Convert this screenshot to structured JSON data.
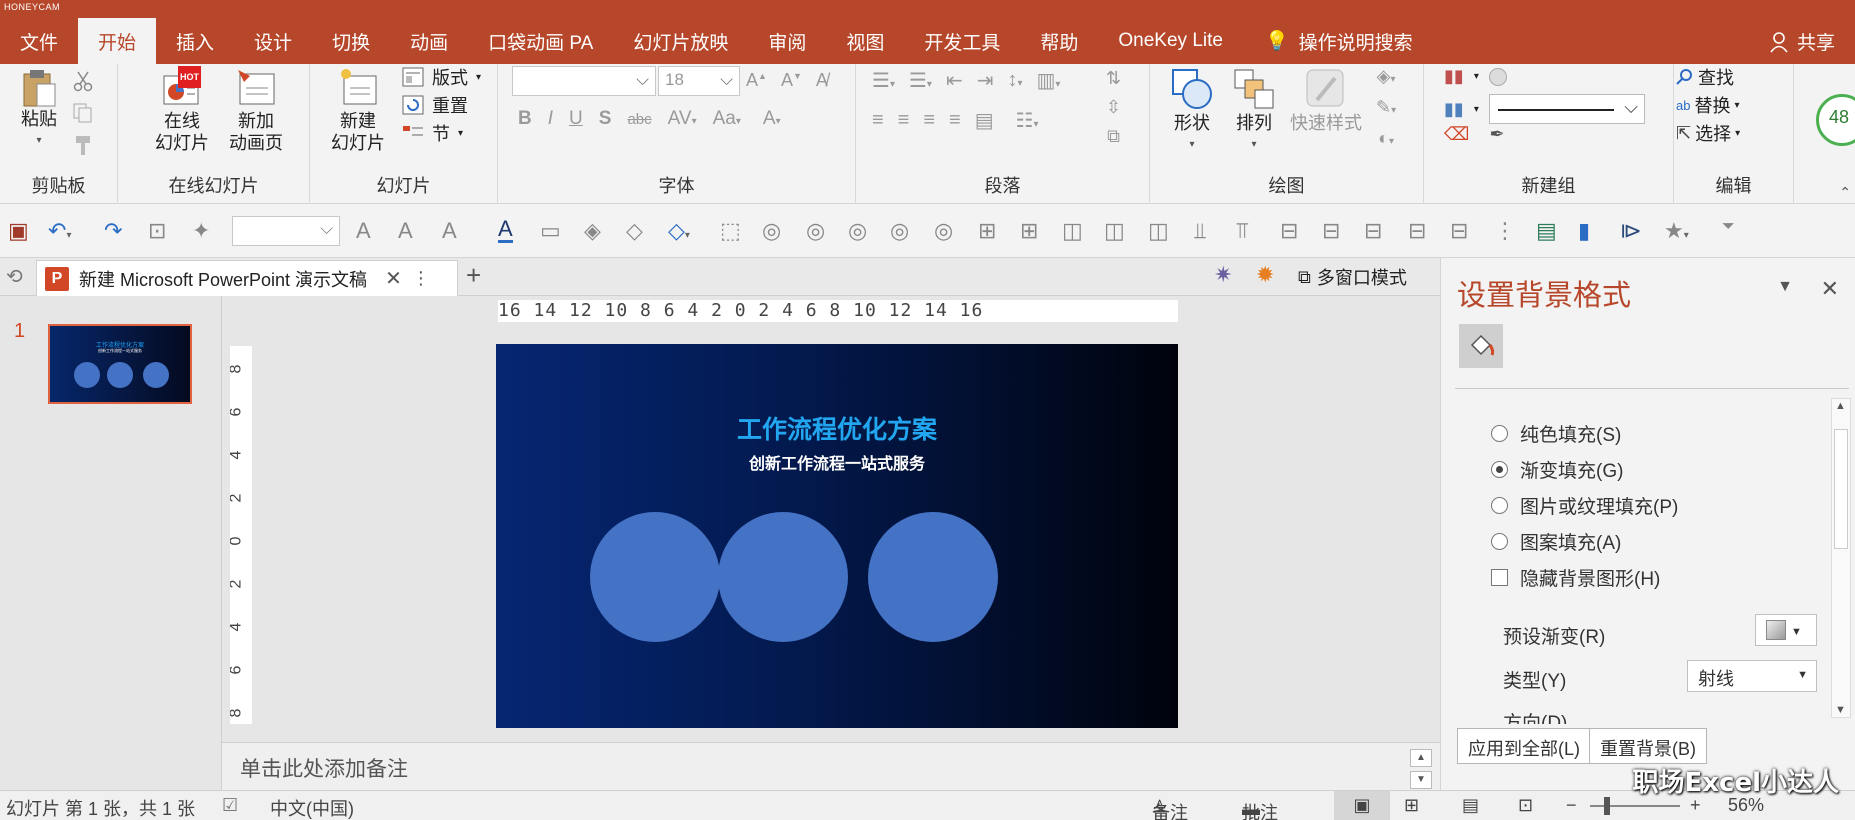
{
  "watermark_top": "HONEYCAM",
  "tabs": [
    "文件",
    "开始",
    "插入",
    "设计",
    "切换",
    "动画",
    "口袋动画 PA",
    "幻灯片放映",
    "审阅",
    "视图",
    "开发工具",
    "帮助",
    "OneKey Lite"
  ],
  "active_tab": "开始",
  "tell_me": "操作说明搜索",
  "share": "共享",
  "ribbon": {
    "clipboard": {
      "paste": "粘贴",
      "label": "剪贴板"
    },
    "online_slides": {
      "online": "在线\n幻灯片",
      "new_anim": "新加\n动画页",
      "hot": "HOT",
      "label": "在线幻灯片"
    },
    "slides": {
      "new_slide": "新建\n幻灯片",
      "layout": "版式",
      "reset": "重置",
      "section": "节",
      "label": "幻灯片"
    },
    "font": {
      "size": "18",
      "label": "字体"
    },
    "paragraph": {
      "label": "段落"
    },
    "drawing": {
      "shapes": "形状",
      "arrange": "排列",
      "quick_styles": "快速样式",
      "label": "绘图"
    },
    "new_group": {
      "label": "新建组"
    },
    "editing": {
      "find": "查找",
      "replace": "替换",
      "select": "选择",
      "label": "编辑"
    },
    "badge": "48"
  },
  "doc_tab": {
    "title": "新建 Microsoft  PowerPoint 演示文稿",
    "multiwin": "多窗口模式"
  },
  "thumb": {
    "number": "1",
    "title": "工作流程优化方案",
    "subtitle": "创新工作流程一站式服务"
  },
  "ruler": {
    "h": "16 14 12 10 8 6 4 2 0 2 4 6 8 10 12 14 16",
    "v": [
      "8",
      "6",
      "4",
      "2",
      "0",
      "2",
      "4",
      "6",
      "8"
    ]
  },
  "slide": {
    "title": "工作流程优化方案",
    "subtitle": "创新工作流程一站式服务"
  },
  "notes_placeholder": "单击此处添加备注",
  "pane": {
    "title": "设置背景格式",
    "options": [
      "纯色填充(S)",
      "渐变填充(G)",
      "图片或纹理填充(P)",
      "图案填充(A)"
    ],
    "selected_option": "渐变填充(G)",
    "hide_bg": "隐藏背景图形(H)",
    "preset_label": "预设渐变(R)",
    "type_label": "类型(Y)",
    "type_value": "射线",
    "direction_label": "方向(D)",
    "apply_all": "应用到全部(L)",
    "reset_bg": "重置背景(B)"
  },
  "status": {
    "slide_count": "幻灯片 第 1 张，共 1 张",
    "language": "中文(中国)",
    "notes": "备注",
    "comments": "批注",
    "zoom": "56%"
  },
  "watermark": "职场Excel小达人",
  "colors": {
    "accent": "#b7472a",
    "slide_title": "#22a6f0",
    "circle": "#4472c4"
  }
}
